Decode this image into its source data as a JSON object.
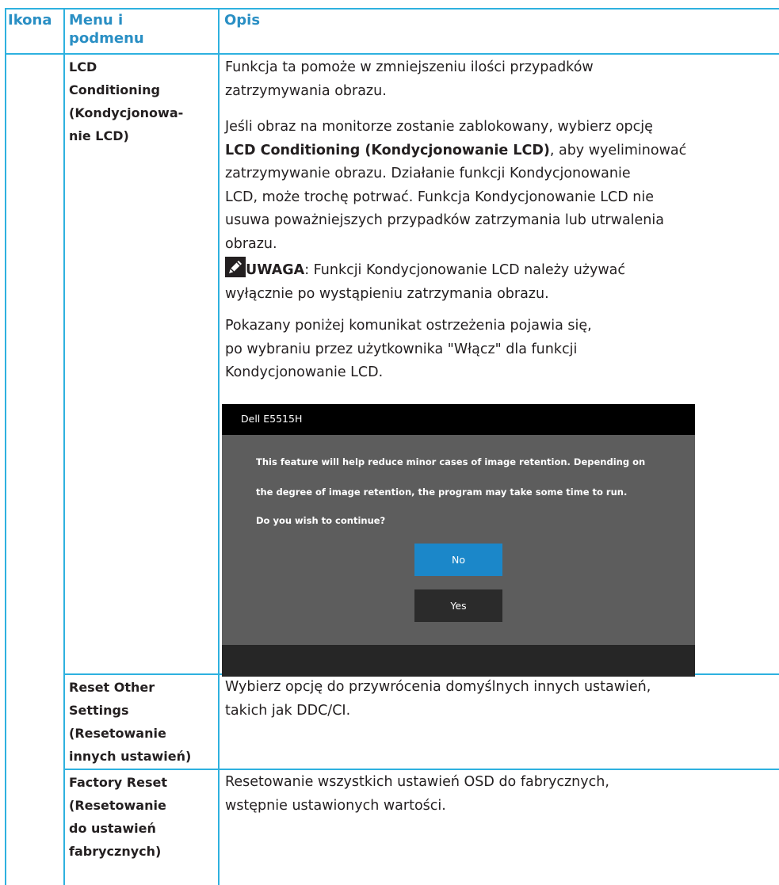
{
  "header": {
    "col_icon": "Ikona",
    "col_menu_line1": "Menu i",
    "col_menu_line2": "podmenu",
    "col_desc": "Opis"
  },
  "rows": [
    {
      "menu_lines": [
        "LCD",
        "Conditioning",
        "(Kondycjonowa-",
        "nie LCD)"
      ],
      "p1_lines": [
        "Funkcja ta pomoże w zmniejszeniu ilości przypadków",
        "zatrzymywania obrazu."
      ],
      "p2_line1": "Jeśli obraz na monitorze zostanie zablokowany, wybierz opcję",
      "p2_bold": "LCD Conditioning (Kondycjonowanie LCD)",
      "p2_after_bold": ", aby wyeliminować",
      "p2_lines": [
        "zatrzymywanie obrazu. Działanie funkcji Kondycjonowanie",
        "LCD, może trochę potrwać. Funkcja Kondycjonowanie LCD nie",
        "usuwa poważniejszych przypadków zatrzymania lub utrwalenia",
        "obrazu."
      ],
      "note_label": "UWAGA",
      "note_text_1": ": Funkcji Kondycjonowanie LCD należy używać",
      "note_text_2": "wyłącznie po wystąpieniu zatrzymania obrazu.",
      "p3_lines": [
        "Pokazany poniżej komunikat ostrzeżenia pojawia się,",
        "po wybraniu przez użytkownika \"Włącz\" dla funkcji",
        "Kondycjonowanie LCD."
      ],
      "dialog": {
        "title": "Dell E5515H",
        "lines": [
          "This feature will help reduce minor cases of image retention. Depending on",
          "the degree of image retention, the program may take some time to run.",
          "Do you wish to continue?"
        ],
        "btn_no": "No",
        "btn_yes": "Yes"
      }
    },
    {
      "menu_lines": [
        "Reset Other",
        "Settings",
        "(Resetowanie",
        "innych ustawień)"
      ],
      "desc_lines": [
        "Wybierz opcję do przywrócenia domyślnych innych ustawień,",
        "takich jak DDC/CI."
      ]
    },
    {
      "menu_lines": [
        "Factory Reset",
        "(Resetowanie",
        "do ustawień",
        "fabrycznych)"
      ],
      "desc_lines": [
        "Resetowanie wszystkich ustawień OSD do fabrycznych,",
        "wstępnie ustawionych wartości."
      ]
    }
  ],
  "colors": {
    "grid": "#2eb1df",
    "header_text": "#2a8fc4",
    "body_text": "#231f20",
    "dialog_bg": "#5d5d5d",
    "dialog_title_bg": "#000000",
    "button_no_bg": "#1b87c9",
    "button_yes_bg": "#2b2b2b"
  },
  "icons": {
    "note": "pencil-note-icon"
  }
}
